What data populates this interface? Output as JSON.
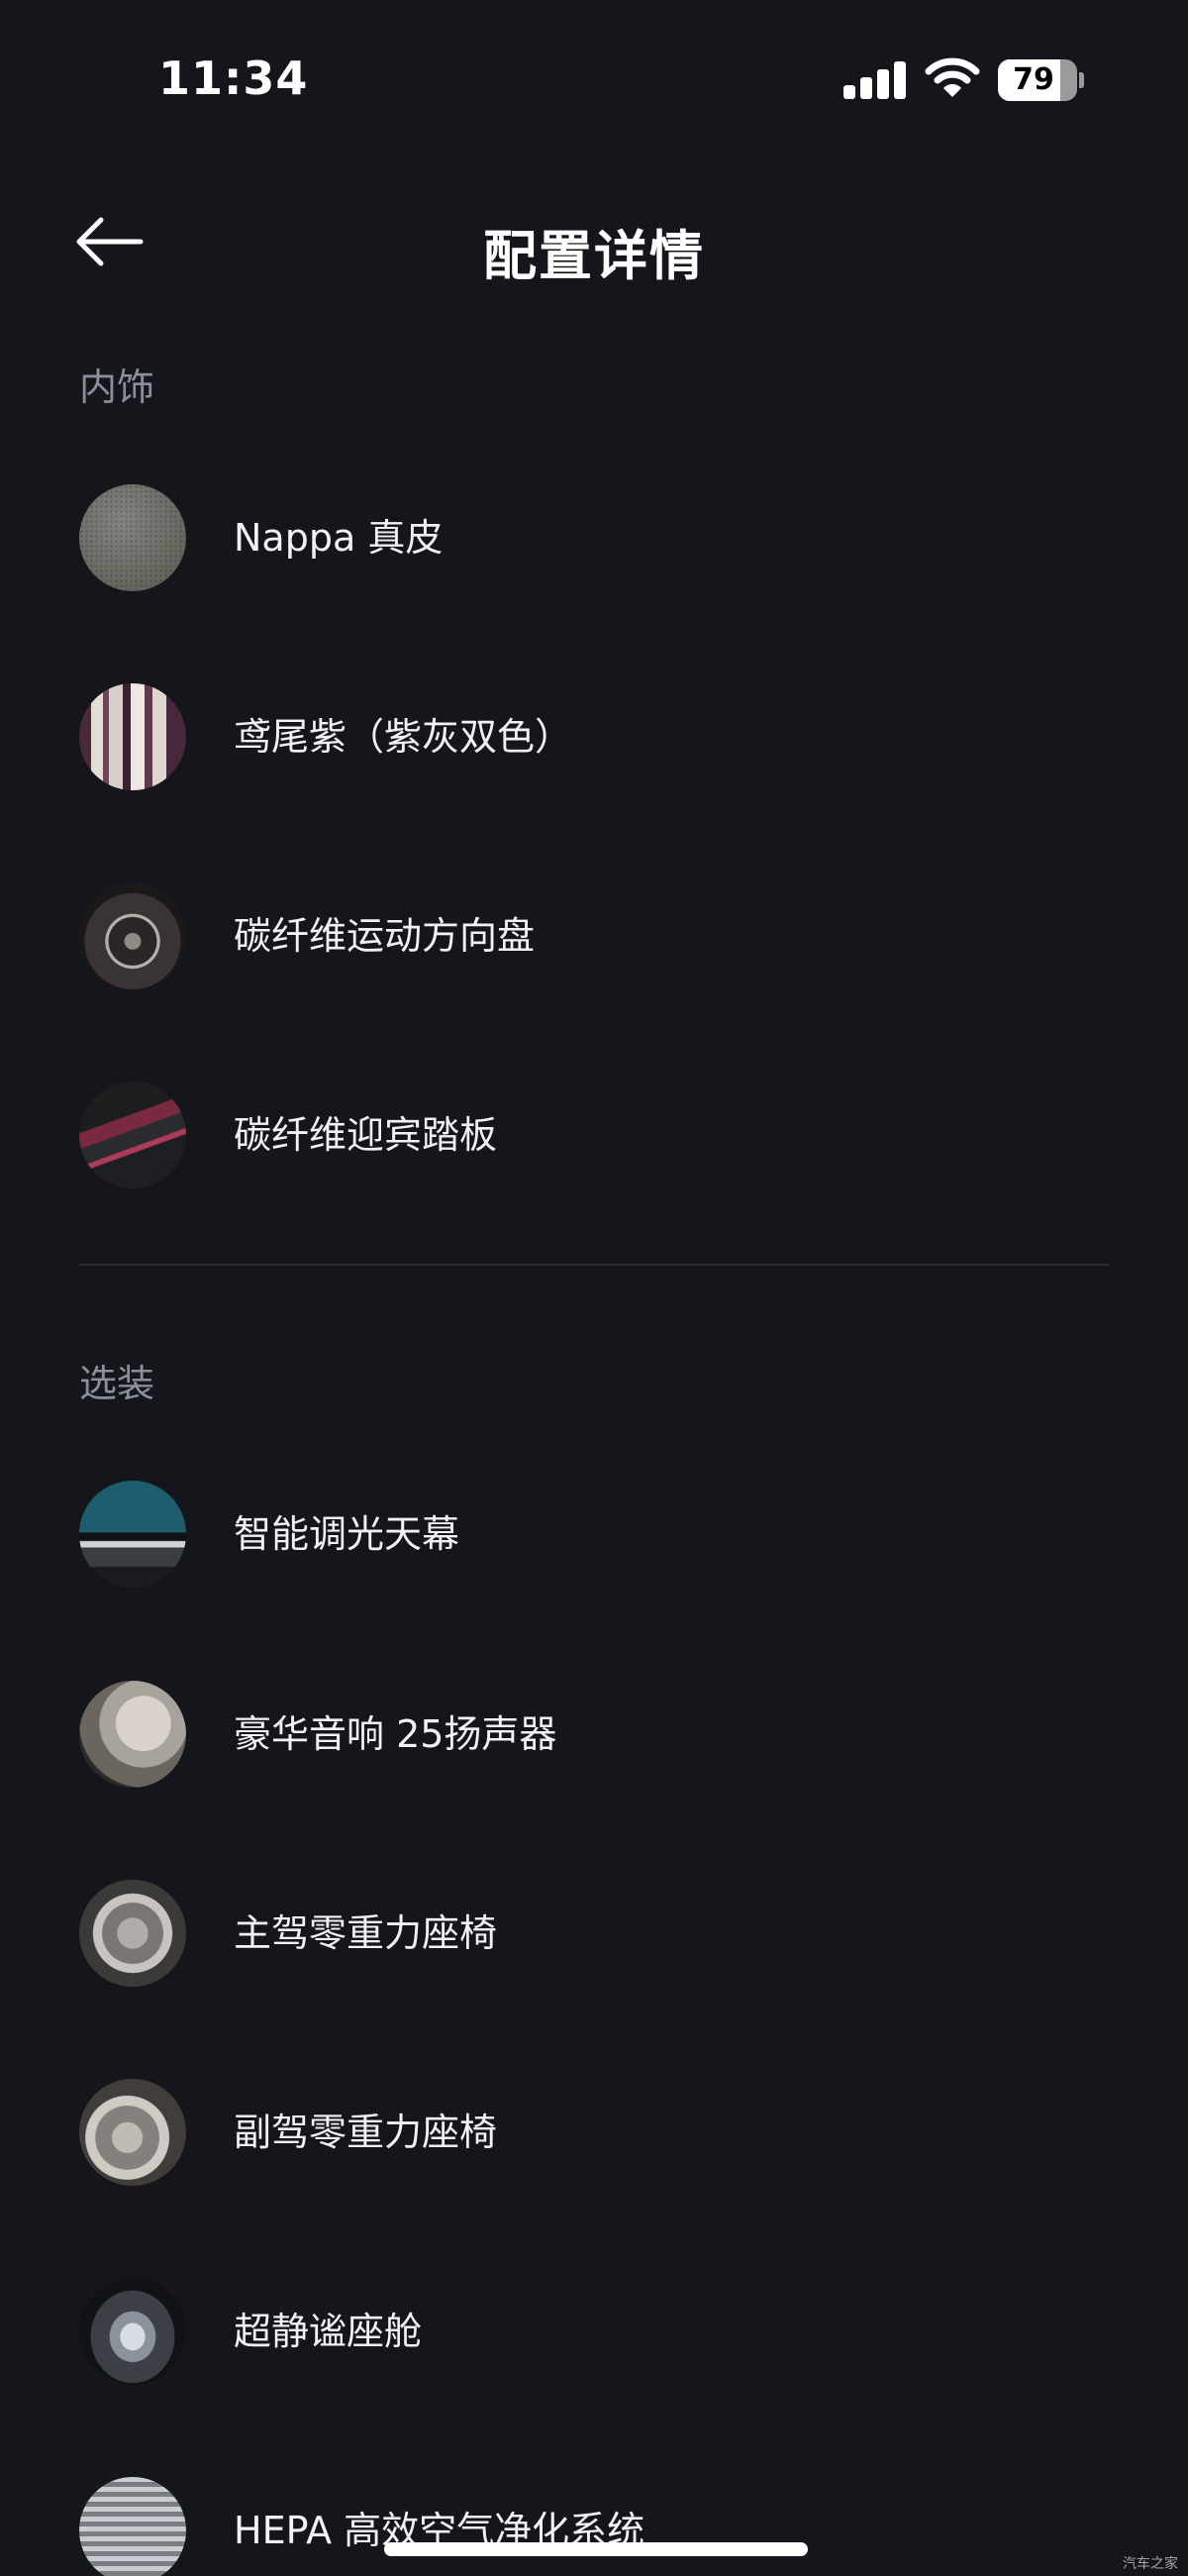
{
  "status_bar": {
    "time": "11:34",
    "battery": "79",
    "battery_level": 0.79
  },
  "header": {
    "title": "配置详情",
    "back_icon": "arrow-left-icon"
  },
  "sections": [
    {
      "title": "内饰",
      "items": [
        {
          "label": "Nappa 真皮"
        },
        {
          "label": "鸢尾紫（紫灰双色）"
        },
        {
          "label": "碳纤维运动方向盘"
        },
        {
          "label": "碳纤维迎宾踏板"
        }
      ]
    },
    {
      "title": "选装",
      "items": [
        {
          "label": "智能调光天幕"
        },
        {
          "label": "豪华音响 25扬声器"
        },
        {
          "label": "主驾零重力座椅"
        },
        {
          "label": "副驾零重力座椅"
        },
        {
          "label": "超静谧座舱"
        },
        {
          "label": "HEPA 高效空气净化系统"
        }
      ]
    }
  ],
  "watermark": "汽车之家",
  "colors": {
    "background": "#14161b",
    "section_title": "#8b8f99",
    "divider": "#2a2d33"
  }
}
